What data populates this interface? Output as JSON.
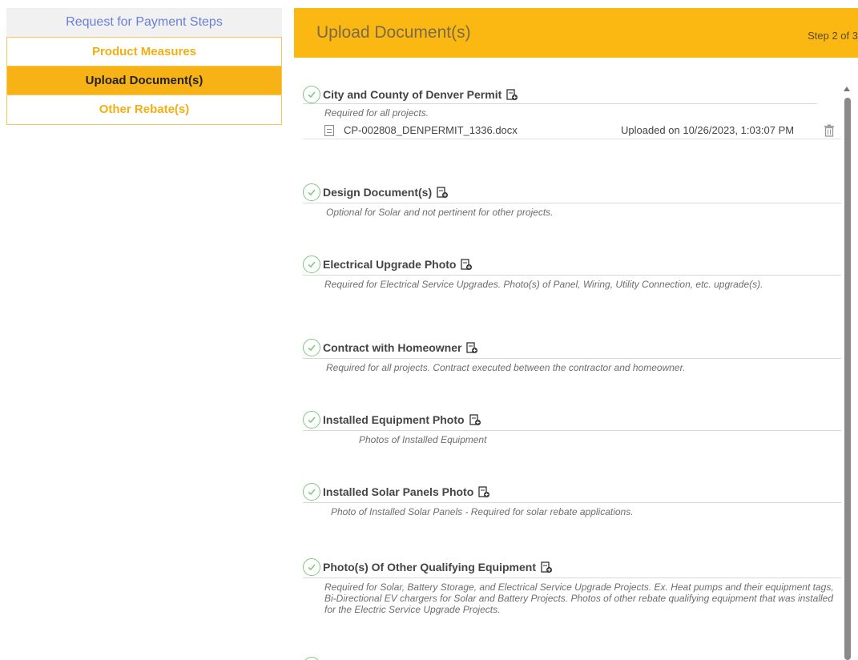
{
  "sidebar": {
    "header": "Request for Payment Steps",
    "items": [
      {
        "label": "Product Measures"
      },
      {
        "label": "Upload Document(s)"
      },
      {
        "label": "Other Rebate(s)"
      }
    ]
  },
  "header": {
    "title": "Upload Document(s)",
    "step": "Step 2 of 3"
  },
  "documents": [
    {
      "title": "City and County of Denver Permit",
      "description": "Required for all projects.",
      "file": {
        "name": "CP-002808_DENPERMIT_1336.docx",
        "uploaded": "Uploaded on 10/26/2023, 1:03:07 PM"
      }
    },
    {
      "title": "Design Document(s)",
      "description": "Optional for Solar and not pertinent for other projects."
    },
    {
      "title": "Electrical Upgrade Photo",
      "description": "Required for Electrical Service Upgrades. Photo(s) of Panel, Wiring, Utility Connection, etc. upgrade(s)."
    },
    {
      "title": "Contract with Homeowner",
      "description": "Required for all projects. Contract executed between the contractor and homeowner."
    },
    {
      "title": "Installed Equipment Photo",
      "description": "Photos of Installed Equipment"
    },
    {
      "title": "Installed Solar Panels Photo",
      "description": "Photo of Installed Solar Panels - Required for solar rebate applications."
    },
    {
      "title": "Photo(s) Of Other Qualifying Equipment",
      "description": "Required for Solar, Battery Storage, and Electrical Service Upgrade Projects. Ex. Heat pumps and their equipment tags, Bi-Directional EV chargers for Solar and Battery Projects. Photos of other rebate qualifying equipment that was installed for the Electric Service Upgrade Projects."
    }
  ],
  "icons": {
    "check": "check-circle-icon",
    "add": "add-file-icon",
    "file": "file-icon",
    "trash": "trash-icon"
  },
  "colors": {
    "accent": "#fbb812",
    "active": "#f7b316",
    "link": "#6b7fd6",
    "check": "#7fc97f"
  }
}
